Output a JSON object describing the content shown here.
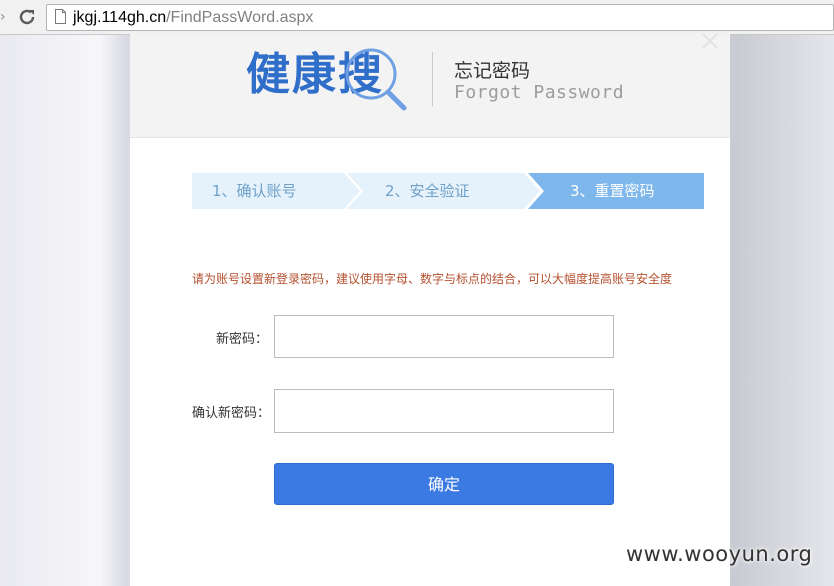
{
  "browser": {
    "url_host": "jkgj.114gh.cn",
    "url_path": "/FindPassWord.aspx"
  },
  "header": {
    "logo_text": "健康搜",
    "title_cn": "忘记密码",
    "title_en": "Forgot Password"
  },
  "steps": [
    {
      "label": "1、确认账号",
      "state": "done"
    },
    {
      "label": "2、安全验证",
      "state": "done"
    },
    {
      "label": "3、重置密码",
      "state": "active"
    }
  ],
  "form": {
    "hint": "请为账号设置新登录密码，建议使用字母、数字与标点的结合，可以大幅度提高账号安全度",
    "new_password_label": "新密码：",
    "new_password_value": "",
    "confirm_password_label": "确认新密码：",
    "confirm_password_value": "",
    "submit_label": "确定"
  },
  "watermark": "www.wooyun.org",
  "colors": {
    "step_inactive_bg": "#e6f2fb",
    "step_active_bg": "#7eb7ec",
    "button_bg": "#3b7ae3",
    "hint_text": "#b5512f",
    "logo": "#2f6ec9"
  }
}
